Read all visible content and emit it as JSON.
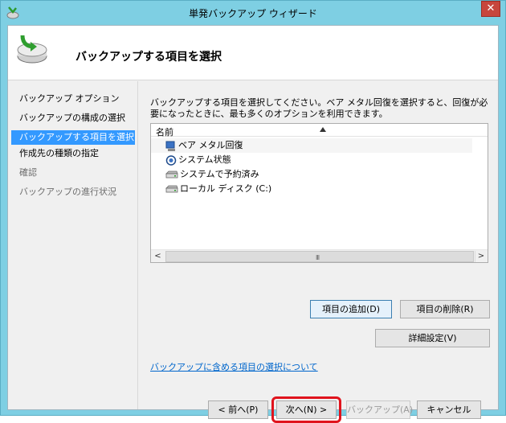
{
  "window": {
    "title": "単発バックアップ ウィザード",
    "close_label": "✕"
  },
  "header": {
    "title": "バックアップする項目を選択"
  },
  "nav": {
    "items": [
      {
        "label": "バックアップ オプション",
        "state": "normal"
      },
      {
        "label": "バックアップの構成の選択",
        "state": "normal"
      },
      {
        "label": "バックアップする項目を選択",
        "state": "selected"
      },
      {
        "label": "作成先の種類の指定",
        "state": "disabled"
      },
      {
        "label": "確認",
        "state": "disabled"
      },
      {
        "label": "バックアップの進行状況",
        "state": "disabled"
      }
    ]
  },
  "content": {
    "description": "バックアップする項目を選択してください。ベア メタル回復を選択すると、回復が必要になったときに、最も多くのオプションを利用できます。",
    "list": {
      "column_header": "名前",
      "items": [
        {
          "label": "ベア メタル回復",
          "icon": "bare-metal-icon"
        },
        {
          "label": "システム状態",
          "icon": "system-state-icon"
        },
        {
          "label": "システムで予約済み",
          "icon": "drive-icon"
        },
        {
          "label": "ローカル ディスク (C:)",
          "icon": "drive-icon"
        }
      ],
      "scroll_left": "<",
      "scroll_right": ">",
      "scroll_grip": "III"
    },
    "add_items_label": "項目の追加(D)",
    "remove_items_label": "項目の削除(R)",
    "advanced_settings_label": "詳細設定(V)",
    "help_link": "バックアップに含める項目の選択について"
  },
  "footer": {
    "back_label": "< 前へ(P)",
    "next_label": "次へ(N) >",
    "backup_label": "バックアップ(A)",
    "cancel_label": "キャンセル"
  },
  "colors": {
    "titlebar": "#7ecfe3",
    "selected_nav": "#3399ff",
    "close_button": "#c7463d",
    "highlight_ring": "#e0141d",
    "link": "#0066cc"
  }
}
